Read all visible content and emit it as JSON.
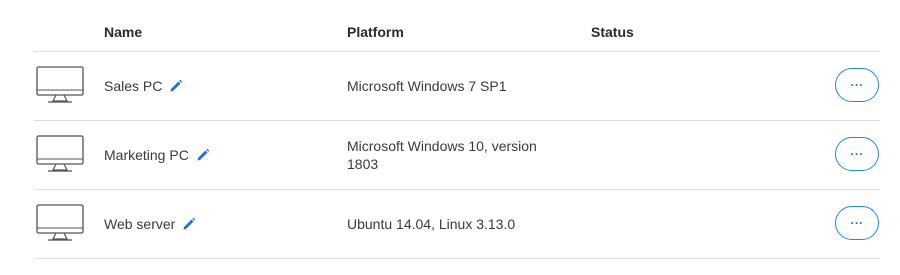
{
  "columns": {
    "name": "Name",
    "platform": "Platform",
    "status": "Status"
  },
  "rows": [
    {
      "name": "Sales PC",
      "platform": "Microsoft Windows 7 SP1",
      "status": "",
      "icon": "desktop-monitor-icon"
    },
    {
      "name": "Marketing PC",
      "platform": "Microsoft Windows 10, version 1803",
      "status": "",
      "icon": "desktop-monitor-icon"
    },
    {
      "name": "Web server",
      "platform": "Ubuntu 14.04, Linux 3.13.0",
      "status": "",
      "icon": "desktop-monitor-icon"
    }
  ],
  "actions": {
    "more_label": "..."
  },
  "colors": {
    "accent": "#1e88e5",
    "divider": "#dcdcdc",
    "icon_gray": "#555555"
  }
}
